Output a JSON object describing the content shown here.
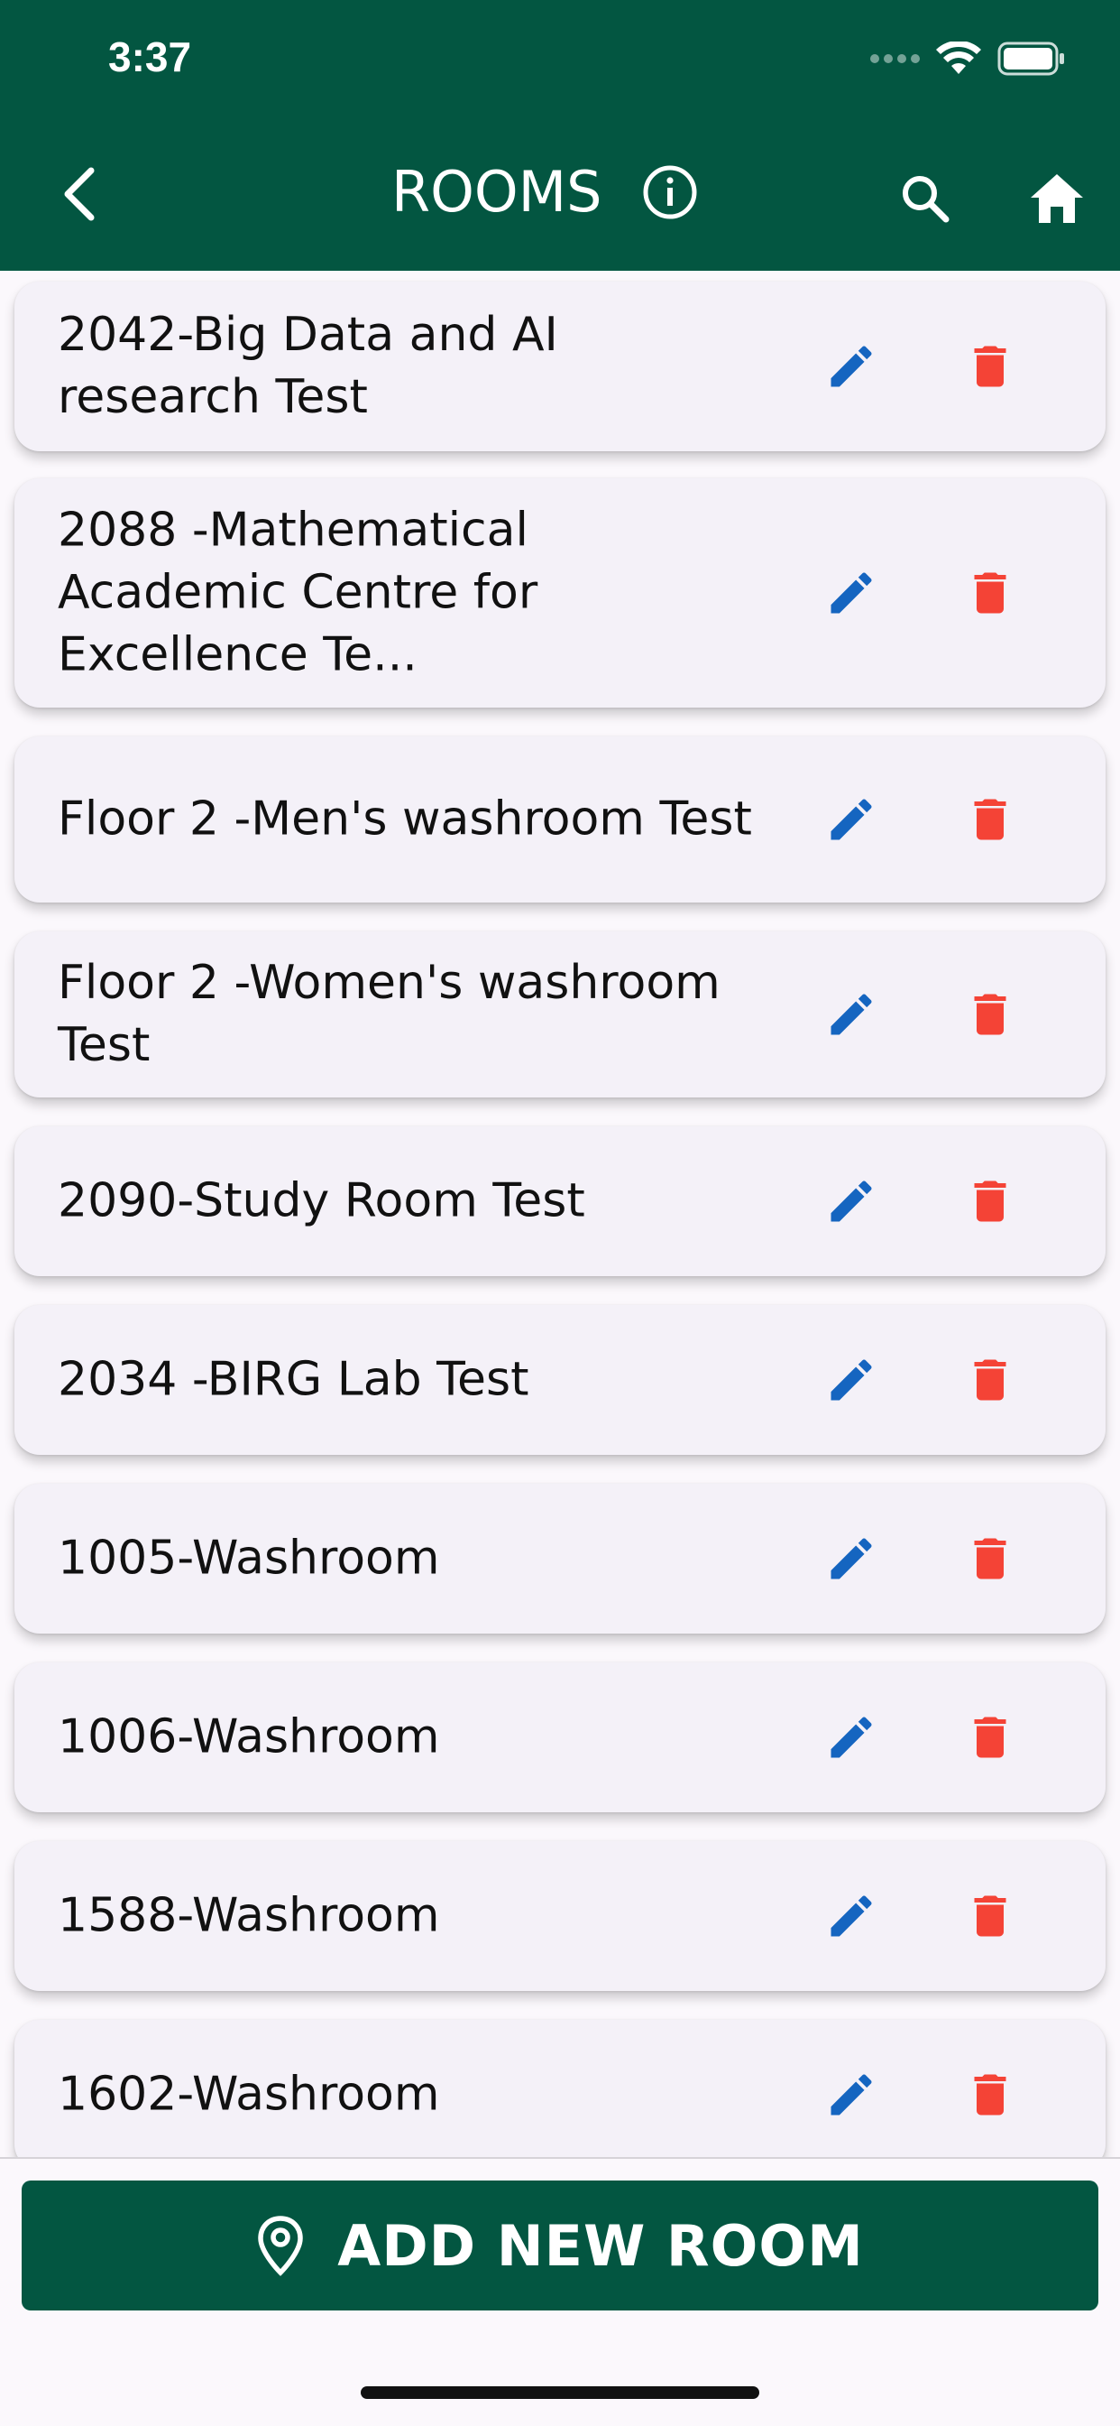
{
  "status_bar": {
    "time": "3:37"
  },
  "header": {
    "title": "ROOMS"
  },
  "rooms": [
    {
      "label": "2042-Big Data and AI research Test"
    },
    {
      "label": "2088 -Mathematical Academic Centre for Excellence Te..."
    },
    {
      "label": "Floor 2 -Men's washroom Test"
    },
    {
      "label": "Floor 2 -Women's washroom Test"
    },
    {
      "label": "2090-Study Room Test"
    },
    {
      "label": "2034 -BIRG Lab Test"
    },
    {
      "label": "1005-Washroom"
    },
    {
      "label": "1006-Washroom"
    },
    {
      "label": "1588-Washroom"
    },
    {
      "label": "1602-Washroom"
    }
  ],
  "footer": {
    "add_label": "ADD NEW ROOM"
  },
  "colors": {
    "primary": "#035641",
    "edit": "#1565c0",
    "delete": "#f44336",
    "card": "#f4f1f8"
  },
  "icons": {
    "back": "chevron-left-icon",
    "info": "info-icon",
    "search": "search-icon",
    "home": "home-icon",
    "edit": "pencil-icon",
    "delete": "trash-icon",
    "add": "location-pin-icon"
  }
}
